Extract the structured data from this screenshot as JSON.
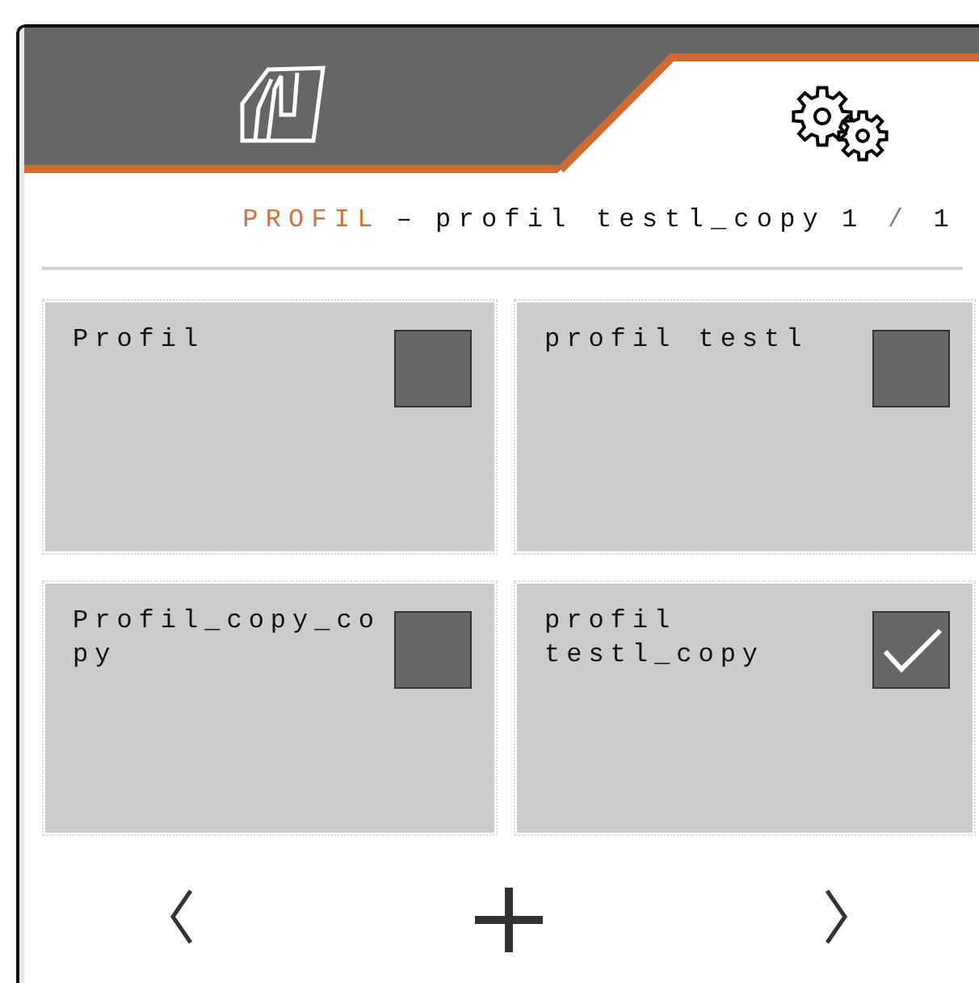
{
  "tabs": [
    {
      "kind": "machine",
      "selected": false
    },
    {
      "kind": "settings",
      "selected": true
    }
  ],
  "header": {
    "section": "PROFIL",
    "separator": "–",
    "name": "profil testl_copy",
    "page": "1",
    "page_separator": "/",
    "page_total": "1"
  },
  "profiles": [
    {
      "name": "Profil",
      "checked": false
    },
    {
      "name": "profil testl",
      "checked": false
    },
    {
      "name": "Profil_copy_copy",
      "checked": false
    },
    {
      "name": "profil testl_copy",
      "checked": true
    }
  ],
  "nav": [
    {
      "kind": "previous"
    },
    {
      "kind": "add"
    },
    {
      "kind": "next"
    }
  ]
}
